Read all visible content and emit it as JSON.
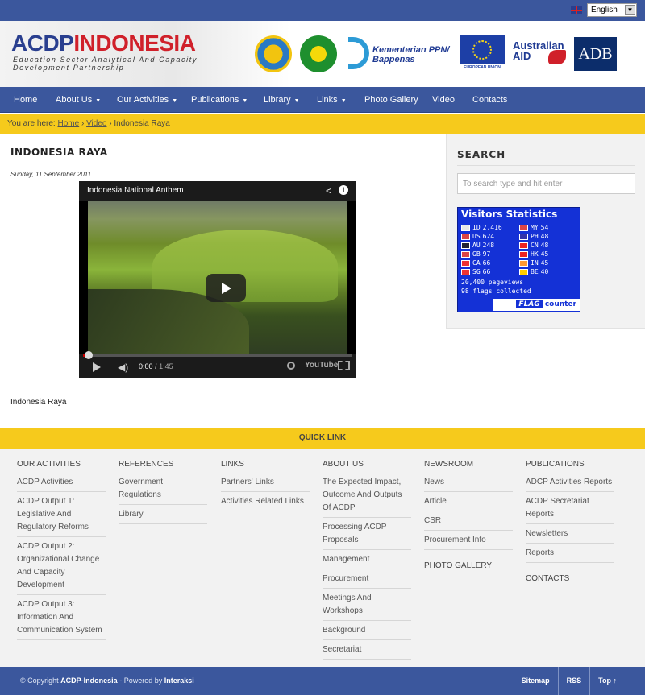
{
  "language": {
    "selected": "English"
  },
  "header": {
    "logo_primary": "ACDP",
    "logo_secondary": "INDONESIA",
    "tagline": "Education Sector Analytical And Capacity Development Partnership",
    "partners": {
      "bappenas": "Kementerian PPN/ Bappenas",
      "eu": "EUROPEAN UNION",
      "australian": "Australian",
      "aid": "AID",
      "adb": "ADB"
    }
  },
  "nav": {
    "items": [
      {
        "label": "Home"
      },
      {
        "label": "About Us"
      },
      {
        "label": "Our Activities"
      },
      {
        "label": "Publications"
      },
      {
        "label": "Library"
      },
      {
        "label": "Links"
      },
      {
        "label": "Photo Gallery"
      },
      {
        "label": "Video"
      },
      {
        "label": "Contacts"
      }
    ],
    "caret": "▼"
  },
  "breadcrumb": {
    "prefix": "You are here:",
    "home": "Home",
    "sep": "›",
    "video": "Video",
    "current": "Indonesia Raya"
  },
  "article": {
    "title": "INDONESIA RAYA",
    "date": "Sunday, 11 September 2011",
    "caption": "Indonesia Raya",
    "video": {
      "title": "Indonesia National Anthem",
      "time_current": "0:00",
      "time_sep": "/",
      "time_total": "1:45",
      "progress": 0.01,
      "youtube": "YouTube"
    }
  },
  "sidebar": {
    "search_title": "SEARCH",
    "search_placeholder": "To search type and hit enter",
    "flag_counter": {
      "title": "Visitors Statistics",
      "rows_left": [
        {
          "code": "ID",
          "count": "2,416",
          "color": "#e8e8e8"
        },
        {
          "code": "US",
          "count": "624",
          "color": "#d44"
        },
        {
          "code": "AU",
          "count": "248",
          "color": "#223"
        },
        {
          "code": "GB",
          "count": "97",
          "color": "#d44"
        },
        {
          "code": "CA",
          "count": "66",
          "color": "#e33"
        },
        {
          "code": "SG",
          "count": "66",
          "color": "#e33"
        }
      ],
      "rows_right": [
        {
          "code": "MY",
          "count": "54",
          "color": "#d44"
        },
        {
          "code": "PH",
          "count": "48",
          "color": "#33a"
        },
        {
          "code": "CN",
          "count": "48",
          "color": "#e22"
        },
        {
          "code": "HK",
          "count": "45",
          "color": "#e22"
        },
        {
          "code": "IN",
          "count": "45",
          "color": "#f93"
        },
        {
          "code": "BE",
          "count": "40",
          "color": "#fc0"
        }
      ],
      "pageviews": "20,400 pageviews",
      "flags_collected": "98 flags collected",
      "badge_flag": "FLAG",
      "badge_counter": "counter"
    }
  },
  "quicklink": {
    "title": "QUICK LINK"
  },
  "footer_cols": {
    "activities": {
      "heading": "OUR ACTIVITIES",
      "links": [
        "ACDP Activities",
        "ACDP Output 1: Legislative And Regulatory Reforms",
        "ACDP Output 2: Organizational Change And Capacity Development",
        "ACDP Output 3: Information And Communication System"
      ]
    },
    "references": {
      "heading": "REFERENCES",
      "links": [
        "Government Regulations",
        "Library"
      ]
    },
    "links": {
      "heading": "LINKS",
      "links": [
        "Partners' Links",
        "Activities Related Links"
      ]
    },
    "about": {
      "heading": "ABOUT US",
      "links": [
        "The Expected Impact, Outcome And Outputs Of ACDP",
        "Processing ACDP Proposals",
        "Management",
        "Procurement",
        "Meetings And Workshops",
        "Background",
        "Secretariat"
      ]
    },
    "newsroom": {
      "heading": "NEWSROOM",
      "links": [
        "News",
        "Article",
        "CSR",
        "Procurement Info"
      ],
      "extra_heading": "PHOTO GALLERY"
    },
    "publications": {
      "heading": "PUBLICATIONS",
      "links": [
        "ADCP Activities Reports",
        "ACDP Secretariat Reports",
        "Newsletters",
        "Reports"
      ],
      "extra_heading": "CONTACTS"
    }
  },
  "bottom": {
    "copyright_prefix": "© Copyright",
    "site": "ACDP-Indonesia",
    "powered": "- Powered by",
    "vendor": "Interaksi",
    "links": [
      "Sitemap",
      "RSS",
      "Top ↑"
    ]
  }
}
